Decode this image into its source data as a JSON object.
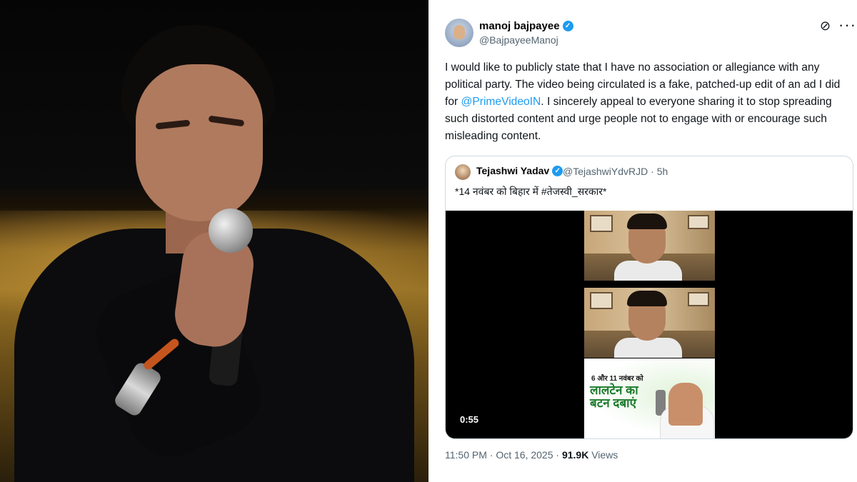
{
  "tweet": {
    "author_name": "manoj bajpayee",
    "author_handle": "@BajpayeeManoj",
    "body_before": "I would like to publicly state that I have no association or allegiance with any political party. The video being circulated is a fake, patched-up edit of an ad I did for ",
    "mention": "@PrimeVideoIN",
    "body_after": ". I sincerely appeal to everyone sharing it to stop spreading such distorted content and urge people not to engage with or encourage such misleading content.",
    "time": "11:50 PM",
    "date": "Oct 16, 2025",
    "views_count": "91.9K",
    "views_label": "Views",
    "icons": [
      "grok-icon",
      "more-options-icon",
      "verified-badge-icon"
    ]
  },
  "quoted": {
    "author_name": "Tejashwi Yadav",
    "author_handle": "@TejashwiYdvRJD · 5h",
    "text": "*14 नवंबर को बिहार में #तेजस्वी_सरकार*",
    "video_duration": "0:55",
    "poster_line1": "6 और 11 नवंबर को",
    "poster_line2": "लालटेन का बटन दबाएं"
  },
  "colors": {
    "accent": "#1d9bf0",
    "text": "#0f1419",
    "muted": "#536471",
    "border": "#cfd9de"
  }
}
